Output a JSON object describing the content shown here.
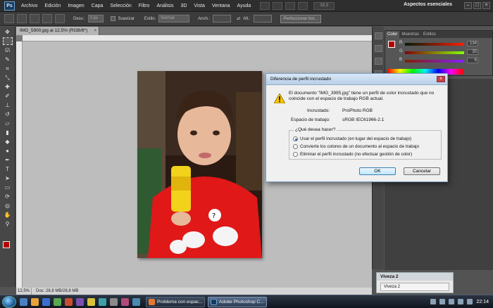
{
  "app": {
    "logo": "Ps",
    "workspace": "Aspectos esenciales",
    "window_controls": [
      "–",
      "□",
      "×"
    ]
  },
  "menu": [
    "Archivo",
    "Edición",
    "Imagen",
    "Capa",
    "Selección",
    "Filtro",
    "Análisis",
    "3D",
    "Vista",
    "Ventana",
    "Ayuda"
  ],
  "zoom_field": "33,3",
  "options": {
    "desvan_label": "Desv.:",
    "desvan_value": "0 px",
    "suavizar_label": "Suavizar",
    "estilo_label": "Estilo:",
    "estilo_value": "Normal",
    "anch_label": "Anch.:",
    "alt_label": "Alt.:",
    "refine_button": "Perfeccionar bor..."
  },
  "document": {
    "tab_title": "IMG_5900.jpg al 12,5% (RGB/8*)",
    "tab_close": "×",
    "status_zoom": "12,5%",
    "status_info": "Doc: 28,8 MB/28,8 MB"
  },
  "color_panel": {
    "tabs": [
      "Color",
      "Muestras",
      "Estilos"
    ],
    "channels": [
      {
        "label": "R",
        "value": "134",
        "color": "#ff0000"
      },
      {
        "label": "G",
        "value": "30",
        "color": "#00c000"
      },
      {
        "label": "B",
        "value": "6",
        "color": "#0000ff"
      }
    ],
    "foreground": "#b30000"
  },
  "dialog": {
    "title": "Diferencia de perfil incrustado",
    "close": "x",
    "message": "El documento \"IMG_3995.jpg\" tiene un perfil de color incrustado que no coincide con el espacio de trabajo RGB actual.",
    "incrustado_label": "Incrustado:",
    "incrustado_value": "ProPhoto RGB",
    "espacio_label": "Espacio de trabajo:",
    "espacio_value": "sRGB IEC61966-2.1",
    "question": "¿Qué desea hacer?",
    "options": [
      "Usar el perfil incrustado (en lugar del espacio de trabajo)",
      "Convierte los colores de un documento al espacio de trabajo",
      "Eliminar el perfil incrustado (no efectuar gestión de color)"
    ],
    "selected_option": 0,
    "ok": "OK",
    "cancel": "Cancelar"
  },
  "viveza": {
    "title": "Viveza 2",
    "item": "Viveza 2"
  },
  "taskbar": {
    "tasks": [
      {
        "label": "Problema con espac...",
        "icon_color": "#e8772e"
      },
      {
        "label": "Adobe Photoshop C...",
        "icon_color": "#1c3b5c"
      }
    ],
    "clock": "22:14"
  }
}
